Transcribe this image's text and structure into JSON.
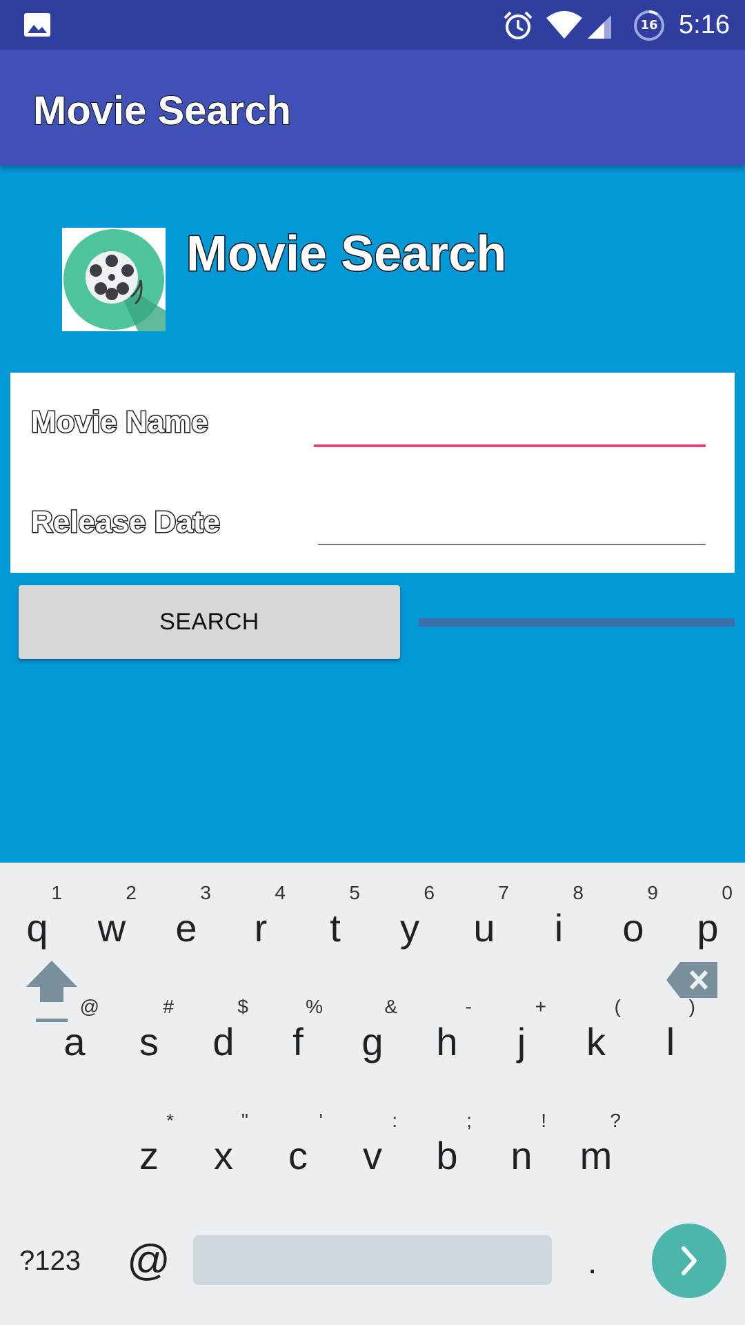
{
  "status_bar": {
    "time": "5:16",
    "battery_level": "16",
    "icons": [
      "gallery-icon",
      "alarm-icon",
      "wifi-icon",
      "cell-signal-icon",
      "battery-icon"
    ]
  },
  "app_bar": {
    "title": "Movie Search"
  },
  "header": {
    "title": "Movie Search",
    "logo_icon": "film-reel-icon"
  },
  "form": {
    "movie_name": {
      "label": "Movie Name",
      "value": "",
      "placeholder": ""
    },
    "release_date": {
      "label": "Release Date",
      "value": "",
      "placeholder": ""
    }
  },
  "search_button": {
    "label": "SEARCH"
  },
  "colors": {
    "status_bar": "#303f9f",
    "app_bar": "#3f51b5",
    "background": "#0398d7",
    "focus_underline": "#ec407a",
    "progress": "#3f6fa8",
    "keyboard_action": "#4db6ac"
  },
  "keyboard": {
    "row1": [
      {
        "letter": "q",
        "hint": "1"
      },
      {
        "letter": "w",
        "hint": "2"
      },
      {
        "letter": "e",
        "hint": "3"
      },
      {
        "letter": "r",
        "hint": "4"
      },
      {
        "letter": "t",
        "hint": "5"
      },
      {
        "letter": "y",
        "hint": "6"
      },
      {
        "letter": "u",
        "hint": "7"
      },
      {
        "letter": "i",
        "hint": "8"
      },
      {
        "letter": "o",
        "hint": "9"
      },
      {
        "letter": "p",
        "hint": "0"
      }
    ],
    "row2": [
      {
        "letter": "a",
        "hint": "@"
      },
      {
        "letter": "s",
        "hint": "#"
      },
      {
        "letter": "d",
        "hint": "$"
      },
      {
        "letter": "f",
        "hint": "%"
      },
      {
        "letter": "g",
        "hint": "&"
      },
      {
        "letter": "h",
        "hint": "-"
      },
      {
        "letter": "j",
        "hint": "+"
      },
      {
        "letter": "k",
        "hint": "("
      },
      {
        "letter": "l",
        "hint": ")"
      }
    ],
    "row3": [
      {
        "letter": "z",
        "hint": "*"
      },
      {
        "letter": "x",
        "hint": "\""
      },
      {
        "letter": "c",
        "hint": "'"
      },
      {
        "letter": "v",
        "hint": ":"
      },
      {
        "letter": "b",
        "hint": ";"
      },
      {
        "letter": "n",
        "hint": "!"
      },
      {
        "letter": "m",
        "hint": "?"
      }
    ],
    "symbols_label": "?123",
    "at_label": "@",
    "period_label": ".",
    "shift_icon": "shift-icon",
    "backspace_icon": "backspace-icon",
    "action_icon": "chevron-right-icon"
  }
}
